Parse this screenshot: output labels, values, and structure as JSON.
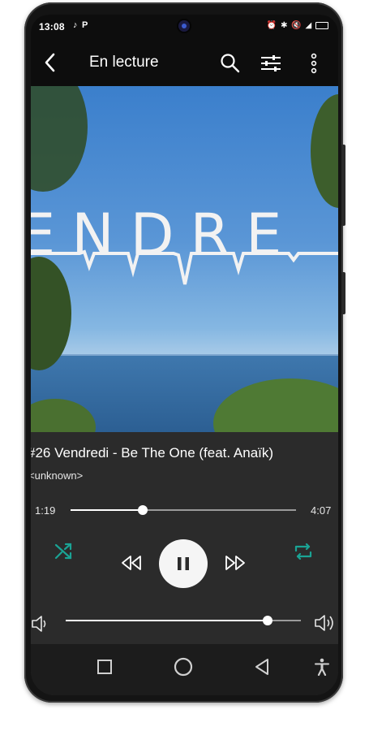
{
  "status_bar": {
    "time": "13:08",
    "left_icons": [
      "music-note-icon",
      "parking-icon"
    ],
    "right_icons": [
      "alarm-icon",
      "bluetooth-icon",
      "mute-icon",
      "signal-icon",
      "battery-icon"
    ]
  },
  "app_bar": {
    "title": "En lecture",
    "back_icon": "arrow-back-icon",
    "actions": [
      "search-icon",
      "equalizer-icon",
      "more-vert-icon"
    ]
  },
  "album_art": {
    "overlay_text": "ENDRE"
  },
  "now_playing": {
    "title": "#26 Vendredi -  Be The One (feat. Anaïk)",
    "artist": "<unknown>"
  },
  "progress": {
    "elapsed": "1:19",
    "duration": "4:07",
    "fraction": 0.32
  },
  "controls": {
    "shuffle_icon": "shuffle-icon",
    "previous_icon": "rewind-icon",
    "play_pause_icon": "pause-icon",
    "next_icon": "fast-forward-icon",
    "repeat_icon": "repeat-icon",
    "accent_color": "#1aa394"
  },
  "volume": {
    "fraction": 0.86,
    "low_icon": "volume-low-icon",
    "high_icon": "volume-high-icon"
  },
  "nav_bar": {
    "buttons": [
      "recents-icon",
      "home-icon",
      "back-triangle-icon",
      "accessibility-icon"
    ]
  }
}
